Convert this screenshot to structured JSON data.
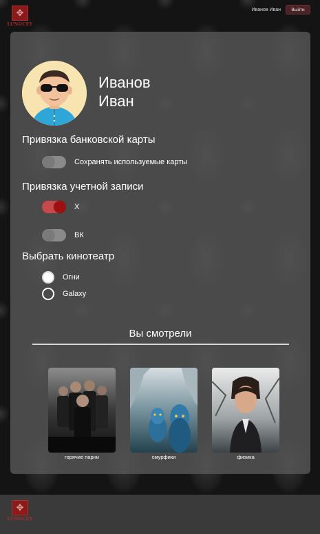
{
  "header": {
    "logo_text": "LUNOCEY",
    "user_name": "Иванов Иван",
    "logout_label": "Выйти"
  },
  "profile": {
    "last_name": "Иванов",
    "first_name": "Иван"
  },
  "bank": {
    "title": "Привязка банковской карты",
    "save_cards_label": "Сохранять используемые карты",
    "save_cards_on": false
  },
  "accounts": {
    "title": "Привязка учетной записи",
    "items": [
      {
        "label": "X",
        "on": true
      },
      {
        "label": "ВК",
        "on": false
      }
    ]
  },
  "cinema": {
    "title": "Выбрать кинотеатр",
    "options": [
      {
        "label": "Огни",
        "selected": true
      },
      {
        "label": "Galaxy",
        "selected": false
      }
    ]
  },
  "watched": {
    "title": "Вы смотрели",
    "movies": [
      {
        "caption": "горячие парни"
      },
      {
        "caption": "смурфики"
      },
      {
        "caption": "физика"
      }
    ]
  },
  "footer": {
    "logo_text": "LUNOCEY"
  },
  "colors": {
    "accent": "#9e0f0f",
    "toggle_on_track": "#c74a4a",
    "card": "#585858",
    "logout_bg": "#4a2326"
  }
}
